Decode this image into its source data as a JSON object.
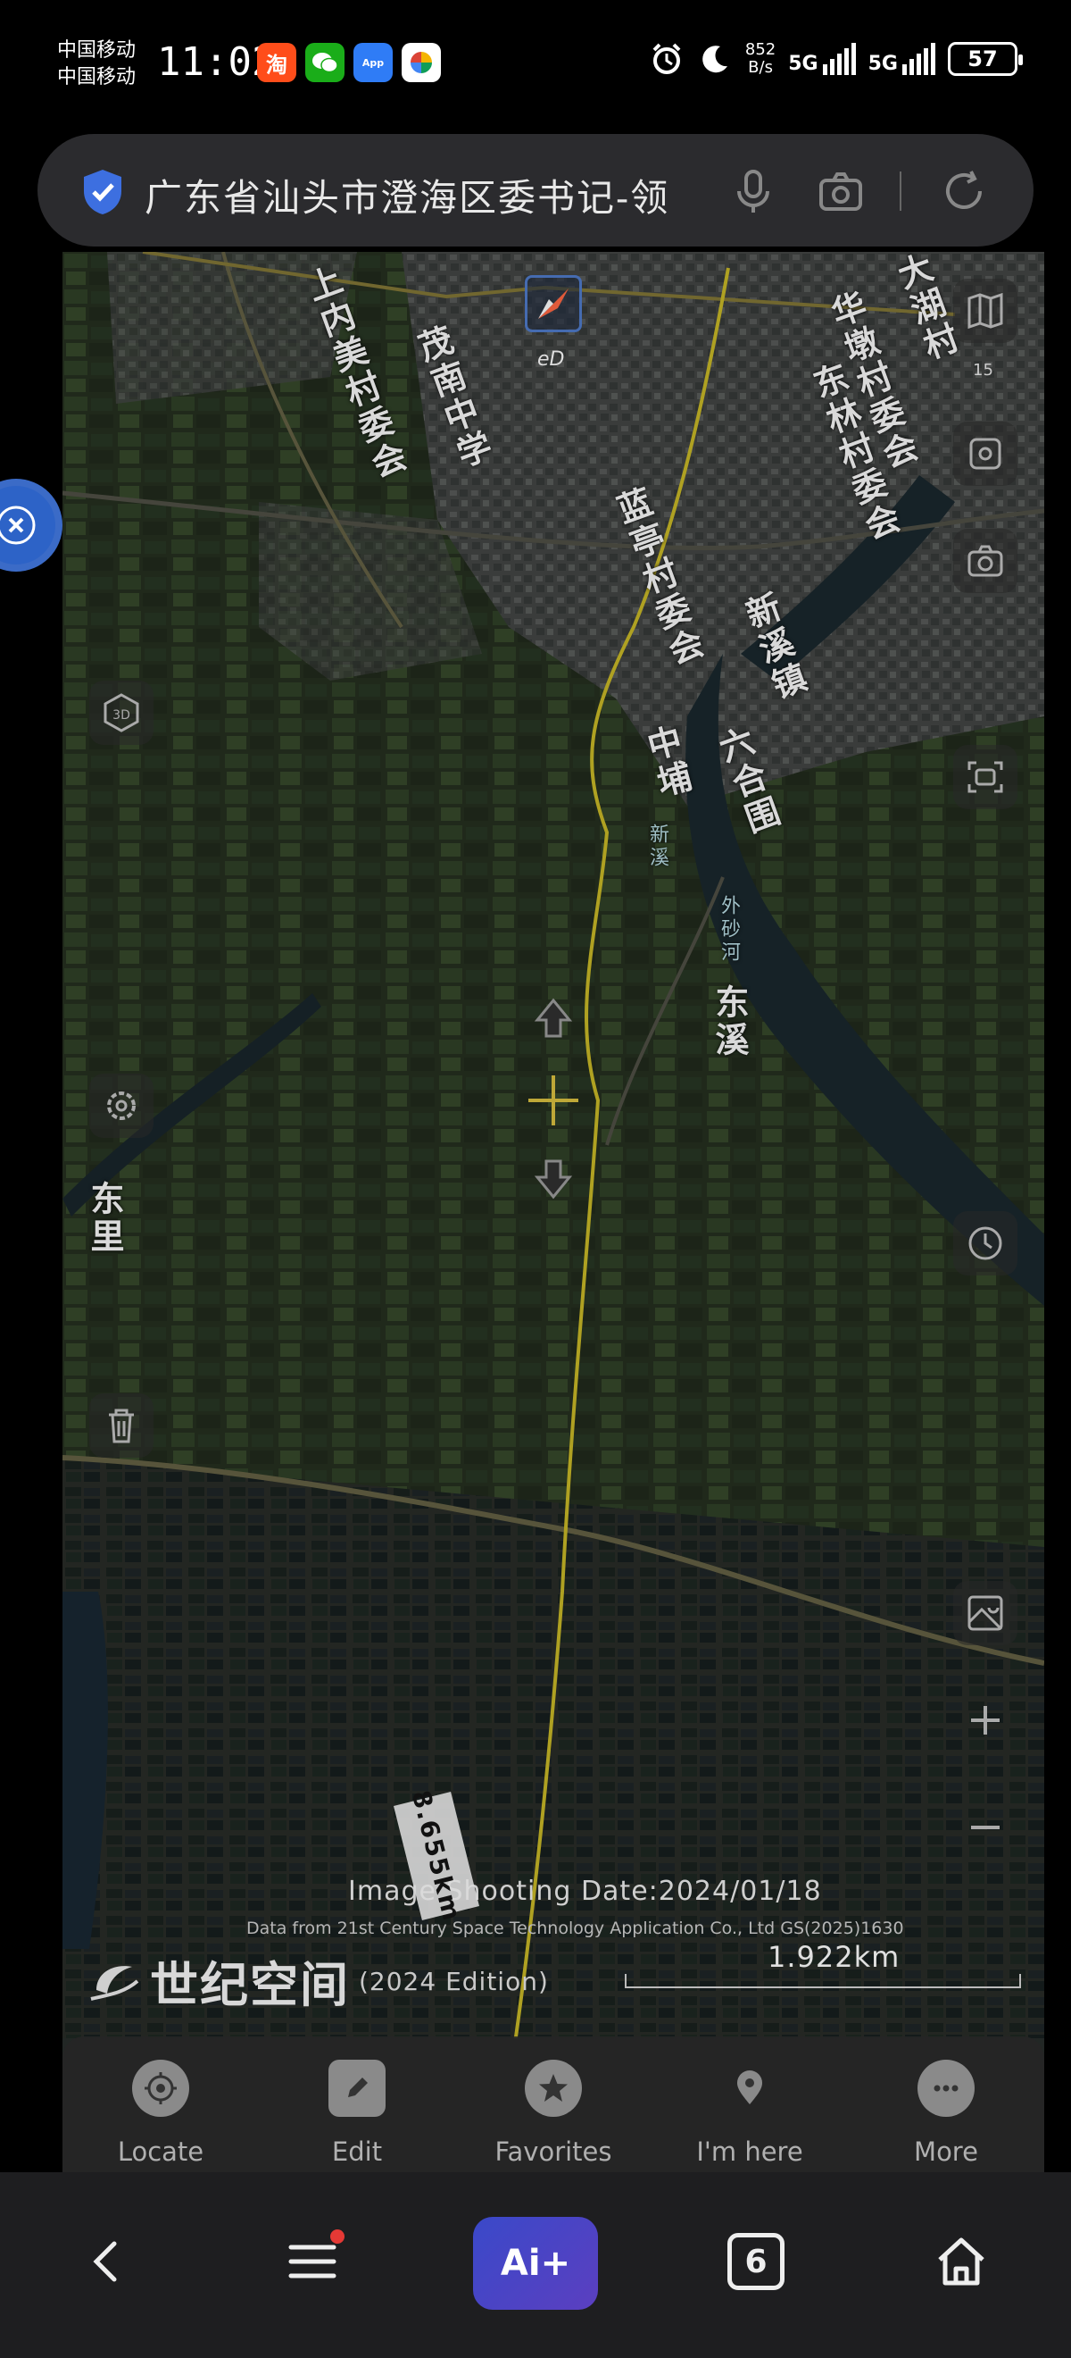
{
  "status_bar": {
    "carrier_1": "中国移动",
    "carrier_2": "中国移动",
    "time": "11:02",
    "net_speed_value": "852",
    "net_speed_unit": "B/s",
    "network_1": "5G",
    "network_2": "5G",
    "battery": "57",
    "icons": [
      "taobao-icon",
      "wechat-icon",
      "app-market-icon",
      "pinwheel-icon",
      "alarm-icon",
      "moon-icon"
    ]
  },
  "search_bar": {
    "query": "广东省汕头市澄海区委书记-领"
  },
  "map": {
    "labels": [
      {
        "text": "上内美村委会"
      },
      {
        "text": "茂南中学"
      },
      {
        "text": "东林村委会"
      },
      {
        "text": "蓝亭村委会"
      },
      {
        "text": "新溪镇"
      },
      {
        "text": "华墩村委会"
      },
      {
        "text": "中埔"
      },
      {
        "text": "东溪"
      },
      {
        "text": "六合围"
      },
      {
        "text": "新溪"
      },
      {
        "text": "外砂河"
      },
      {
        "text": "东里"
      },
      {
        "text": "大湖村"
      }
    ],
    "compass_label": "eD",
    "zoom_level": "15",
    "shooting_date": "Image Shooting Date:2024/01/18",
    "credit": "Data from 21st Century Space Technology Application Co., Ltd GS(2025)1630",
    "logo_text": "世纪空间",
    "edition": "(2024 Edition)",
    "scale_label": "1.922km",
    "distance_tag": "8.655km",
    "side_tools": [
      "map-layers-icon",
      "screenshot-icon",
      "camera-icon",
      "capture-icon",
      "3d-icon",
      "settings-icon",
      "history-icon",
      "delete-icon",
      "map-filter-icon",
      "zoom-in-icon",
      "zoom-out-icon"
    ]
  },
  "toolbar": {
    "items": [
      {
        "label": "Locate",
        "icon": "locate-icon"
      },
      {
        "label": "Edit",
        "icon": "edit-icon"
      },
      {
        "label": "Favorites",
        "icon": "star-icon"
      },
      {
        "label": "I'm here",
        "icon": "pin-icon"
      },
      {
        "label": "More",
        "icon": "more-icon"
      }
    ]
  },
  "nav_bar": {
    "ai_label": "Ai+",
    "tab_count": "6"
  },
  "colors": {
    "track": "#d6c52a",
    "accent_blue": "#2d63c7",
    "ai_button": "#3a49c9"
  }
}
